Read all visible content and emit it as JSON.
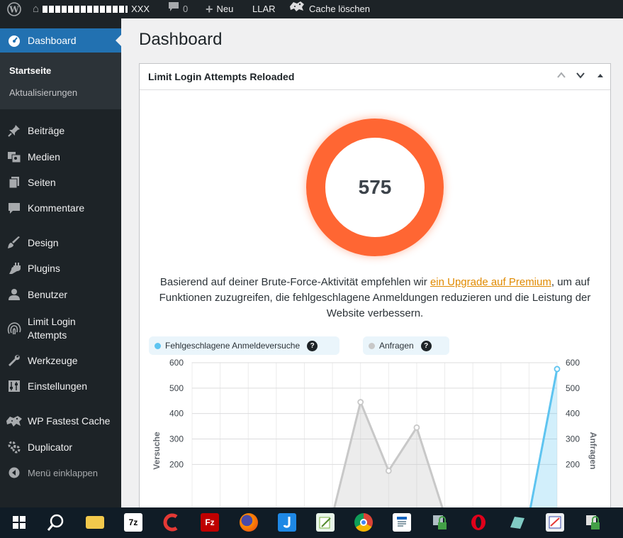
{
  "adminbar": {
    "site_name": "XXX",
    "comments_count": "0",
    "new_label": "Neu",
    "llar_label": "LLAR",
    "cache_label": "Cache löschen"
  },
  "sidebar": {
    "dashboard": "Dashboard",
    "submenu": [
      "Startseite",
      "Aktualisierungen"
    ],
    "items": [
      {
        "label": "Beiträge",
        "icon": "pin-icon"
      },
      {
        "label": "Medien",
        "icon": "media-icon"
      },
      {
        "label": "Seiten",
        "icon": "pages-icon"
      },
      {
        "label": "Kommentare",
        "icon": "comment-icon"
      },
      {
        "label": "Design",
        "icon": "brush-icon"
      },
      {
        "label": "Plugins",
        "icon": "plugin-icon"
      },
      {
        "label": "Benutzer",
        "icon": "user-icon"
      },
      {
        "label": "Limit Login Attempts",
        "icon": "fingerprint-icon"
      },
      {
        "label": "Werkzeuge",
        "icon": "wrench-icon"
      },
      {
        "label": "Einstellungen",
        "icon": "settings-icon"
      },
      {
        "label": "WP Fastest Cache",
        "icon": "cheetah-icon"
      },
      {
        "label": "Duplicator",
        "icon": "duplicator-icon"
      }
    ],
    "collapse": "Menü einklappen"
  },
  "page": {
    "title": "Dashboard"
  },
  "widget": {
    "title": "Limit Login Attempts Reloaded",
    "donut_value": "575",
    "rec_before": "Basierend auf deiner Brute-Force-Aktivität empfehlen wir ",
    "rec_link": "ein Upgrade auf Premium",
    "rec_after": ", um auf Funktionen zuzugreifen, die fehlgeschlagene Anmeldungen reduzieren und die Leistung der Website verbessern.",
    "legend_failed": "Fehlgeschlagene Anmeldeversuche",
    "legend_requests": "Anfragen",
    "help_glyph": "?"
  },
  "colors": {
    "accent": "#2271b1",
    "donut": "#ff6633",
    "failed_series": "#5ec4f0",
    "requests_series": "#c8c8c8",
    "link": "#e08a00"
  },
  "chart_data": {
    "type": "line",
    "x": [
      0,
      1,
      2,
      3,
      4,
      5,
      6,
      7,
      8,
      9,
      10,
      11,
      12,
      13
    ],
    "ylabel_left": "Versuche",
    "ylabel_right": "Anfragen",
    "y_ticks": [
      200,
      300,
      400,
      500,
      600
    ],
    "ylim": [
      0,
      600
    ],
    "series": [
      {
        "name": "Fehlgeschlagene Anmeldeversuche",
        "axis": "left",
        "color": "#5ec4f0",
        "values": [
          0,
          0,
          0,
          0,
          0,
          0,
          0,
          0,
          0,
          0,
          0,
          0,
          0,
          575
        ]
      },
      {
        "name": "Anfragen",
        "axis": "right",
        "color": "#c8c8c8",
        "values": [
          0,
          0,
          0,
          0,
          0,
          0,
          445,
          175,
          345,
          0,
          0,
          0,
          0,
          0
        ]
      }
    ]
  },
  "taskbar": {
    "icons": [
      "windows-start-icon",
      "search-icon",
      "file-explorer-icon",
      "7zip-icon",
      "ccleaner-icon",
      "filezilla-icon",
      "firefox-icon",
      "dev-app-icon",
      "notepad-plus-icon",
      "chrome-icon",
      "document-icon",
      "lock-app-icon",
      "opera-icon",
      "glass-app-icon",
      "editor-icon",
      "lock-app-2-icon"
    ],
    "sevenzip_label": "7z",
    "filezilla_label": "Fz"
  }
}
